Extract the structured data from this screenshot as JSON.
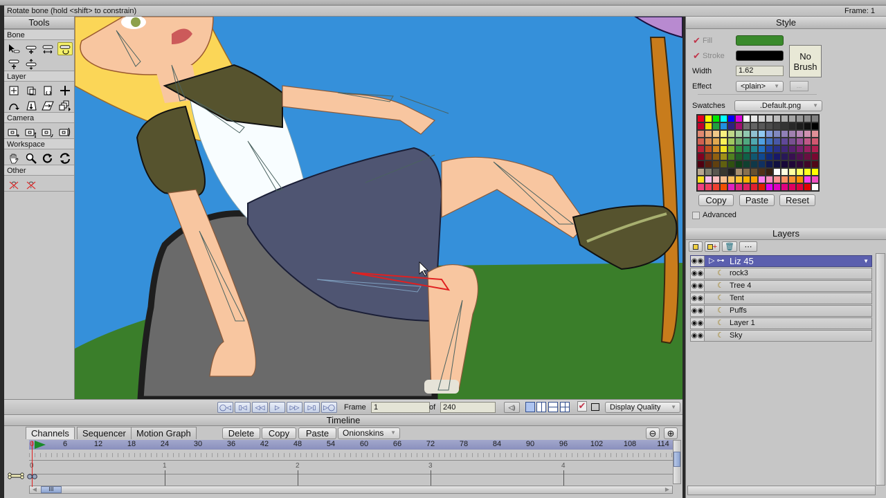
{
  "status": {
    "hint": "Rotate bone (hold <shift> to constrain)",
    "frame_label": "Frame: 1"
  },
  "tools": {
    "title": "Tools",
    "sections": [
      {
        "label": "Bone",
        "icons": [
          "select-bone-icon",
          "add-bone-icon",
          "translate-bone-icon",
          "rotate-bone-icon",
          "bone-strength-icon",
          "manipulate-bones-icon"
        ]
      },
      {
        "label": "Layer",
        "icons": [
          "set-origin-icon",
          "transform-layer-icon",
          "rotate-layer-icon",
          "translate-icon",
          "follow-path-icon",
          "shear-layer-icon",
          "perspective-icon",
          "layer-stack-icon"
        ]
      },
      {
        "label": "Camera",
        "icons": [
          "track-camera-icon",
          "zoom-camera-icon",
          "roll-camera-icon",
          "pan-tilt-camera-icon"
        ]
      },
      {
        "label": "Workspace",
        "icons": [
          "hand-pan-icon",
          "magnifier-icon",
          "rotate-workspace-icon",
          "orbit-workspace-icon"
        ]
      },
      {
        "label": "Other",
        "icons": [
          "missing-tool-icon",
          "missing-tool-icon"
        ]
      }
    ],
    "active_tool": "rotate-bone-icon"
  },
  "playback": {
    "buttons": [
      "rewind-start",
      "previous-keyframe",
      "step-back",
      "play",
      "step-forward",
      "next-keyframe",
      "jump-end"
    ],
    "frame_label": "Frame",
    "frame_value": "1",
    "of_label": "of",
    "total_frames": "240",
    "display_quality_label": "Display Quality"
  },
  "timeline": {
    "title": "Timeline",
    "tabs": [
      "Channels",
      "Sequencer",
      "Motion Graph"
    ],
    "active_tab": "Channels",
    "buttons": {
      "delete": "Delete",
      "copy": "Copy",
      "paste": "Paste",
      "onionskins": "Onionskins"
    },
    "ruler": [
      "0",
      "6",
      "12",
      "18",
      "24",
      "30",
      "36",
      "42",
      "48",
      "54",
      "60",
      "66",
      "72",
      "78",
      "84",
      "90",
      "96",
      "102",
      "108",
      "114"
    ],
    "seconds": [
      "0",
      "1",
      "2",
      "3",
      "4"
    ],
    "current_frame": 0
  },
  "style": {
    "title": "Style",
    "fill_label": "Fill",
    "stroke_label": "Stroke",
    "fill_color": "#3a8a2c",
    "stroke_color": "#000000",
    "width_label": "Width",
    "width_value": "1.62",
    "effect_label": "Effect",
    "effect_value": "<plain>",
    "effect_more": "...",
    "brush_label": "No Brush",
    "swatches_label": "Swatches",
    "swatches_value": ".Default.png",
    "copy": "Copy",
    "paste": "Paste",
    "reset": "Reset",
    "advanced_label": "Advanced",
    "palette": [
      "#e8001c",
      "#ffff00",
      "#00e800",
      "#00ffff",
      "#0000ff",
      "#e000e0",
      "#ffffff",
      "#e8e8e8",
      "#d4d4d4",
      "#c8c8c8",
      "#bcbcbc",
      "#b0b0b0",
      "#a4a4a4",
      "#989898",
      "#8c8c8c",
      "#808080",
      "#c0002a",
      "#f0e000",
      "#20a040",
      "#2090e0",
      "#302080",
      "#a01070",
      "#707070",
      "#646464",
      "#585858",
      "#4c4c4c",
      "#404040",
      "#343434",
      "#282828",
      "#1c1c1c",
      "#101010",
      "#000000",
      "#e08870",
      "#e8a878",
      "#f0c888",
      "#f8f080",
      "#c0d888",
      "#a8d0a0",
      "#90c8b0",
      "#90c0d0",
      "#90c8f0",
      "#8098d8",
      "#8088c0",
      "#9080b8",
      "#a080b0",
      "#b888b8",
      "#d090b0",
      "#e09098",
      "#d06050",
      "#d88850",
      "#e0a850",
      "#f8f058",
      "#a0c860",
      "#70b070",
      "#50a880",
      "#50a8b0",
      "#50a0e0",
      "#4070c0",
      "#4858a8",
      "#604898",
      "#785090",
      "#985098",
      "#c05888",
      "#d05870",
      "#b82038",
      "#c05020",
      "#d08820",
      "#f0e020",
      "#80b030",
      "#309040",
      "#208860",
      "#208890",
      "#2070c0",
      "#2040a0",
      "#283088",
      "#402878",
      "#582070",
      "#782070",
      "#982060",
      "#b02050",
      "#800020",
      "#883818",
      "#906010",
      "#a09018",
      "#508020",
      "#206028",
      "#106048",
      "#105870",
      "#104890",
      "#102878",
      "#181868",
      "#281858",
      "#381050",
      "#501050",
      "#681040",
      "#780830",
      "#500010",
      "#582010",
      "#604010",
      "#606010",
      "#305010",
      "#104018",
      "#104030",
      "#103848",
      "#103060",
      "#101850",
      "#101040",
      "#180838",
      "#200838",
      "#300838",
      "#400828",
      "#500818",
      "#b8a890",
      "#808070",
      "#585850",
      "#383830",
      "#202020",
      "#a89070",
      "#887050",
      "#685030",
      "#503018",
      "#382010",
      "#ffffff",
      "#ffffe0",
      "#ffffa0",
      "#ffff60",
      "#ffff20",
      "#ffff00",
      "#f8e020",
      "#f8c0f0",
      "#f8c0c0",
      "#f8c090",
      "#f8c060",
      "#f8c030",
      "#f8b000",
      "#f8a000",
      "#f880f0",
      "#f890c0",
      "#f89090",
      "#f89060",
      "#f89030",
      "#f89000",
      "#f840f0",
      "#f050c0",
      "#f04080",
      "#f04060",
      "#f04030",
      "#f05000",
      "#e020c0",
      "#e02080",
      "#e02060",
      "#e02030",
      "#e02000",
      "#e000f0",
      "#e000c0",
      "#e00080",
      "#e00060",
      "#e00040",
      "#e00000",
      "#ffffff"
    ]
  },
  "layers": {
    "title": "Layers",
    "toolbar": [
      "new-layer-icon",
      "new-layer-add-icon",
      "delete-layer-icon",
      "more-icon"
    ],
    "items": [
      {
        "name": "Liz 45",
        "type": "bone",
        "selected": true
      },
      {
        "name": "rock3",
        "type": "vector",
        "selected": false
      },
      {
        "name": "Tree 4",
        "type": "vector",
        "selected": false
      },
      {
        "name": "Tent",
        "type": "vector",
        "selected": false
      },
      {
        "name": "Puffs",
        "type": "vector",
        "selected": false
      },
      {
        "name": "Layer 1",
        "type": "vector",
        "selected": false
      },
      {
        "name": "Sky",
        "type": "vector",
        "selected": false
      }
    ]
  }
}
